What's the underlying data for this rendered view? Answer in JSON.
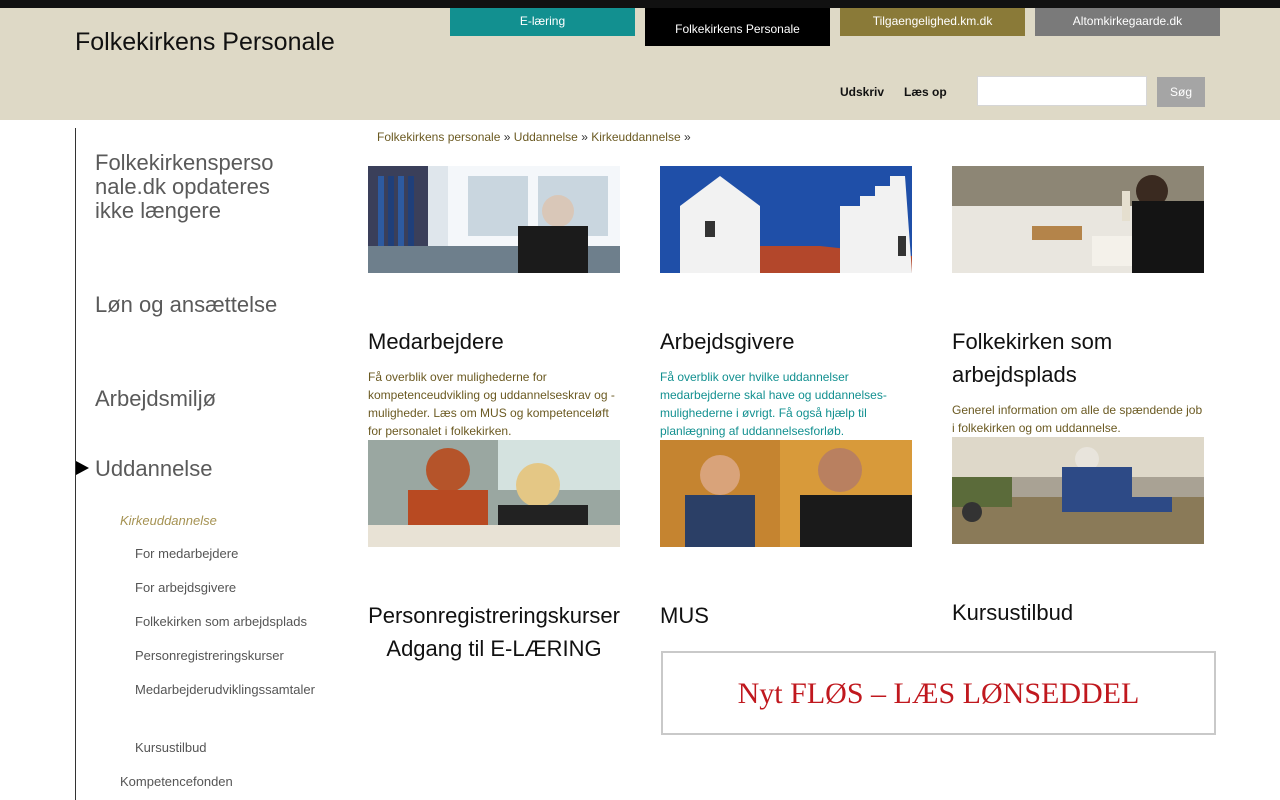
{
  "header": {
    "site_title": "Folkekirkens Personale",
    "tabs": [
      {
        "label": "E-læring",
        "color": "#129090"
      },
      {
        "label": "Folkekirkens Personale",
        "color": "#000000"
      },
      {
        "label": "Tilgaengelighed.km.dk",
        "color": "#8a7a38"
      },
      {
        "label": "Altomkirkegaarde.dk",
        "color": "#7a7a7a"
      }
    ],
    "print_label": "Udskriv",
    "read_label": "Læs op",
    "search_value": "",
    "search_button": "Søg"
  },
  "sidebar": {
    "main": [
      "Folkekirkenspersonale.dk opdateres ikke længere",
      "Løn og ansættelse",
      "Arbejdsmiljø",
      "Uddannelse"
    ],
    "active_sub": "Kirkeuddannelse",
    "sub_items": [
      "For medarbejdere",
      "For arbejdsgivere",
      "Folkekirken som arbejdsplads",
      "Personregistreringskurser",
      "Medarbejderudviklingssamtaler",
      "Kursustilbud"
    ],
    "next_sub": "Kompetencefonden"
  },
  "breadcrumb": {
    "items": [
      "Folkekirkens personale",
      "Uddannelse",
      "Kirkeuddannelse"
    ],
    "separator": "»"
  },
  "cards": {
    "row1": [
      {
        "title": "Medarbejdere",
        "desc": "Få overblik over mulighederne for kompetenceudvikling og uddannelseskrav og -muligheder. Læs om MUS og kompetenceløft for personalet i folkekirken."
      },
      {
        "title": "Arbejdsgivere",
        "desc": "Få overblik over hvilke uddannelser medarbejderne skal have og uddannelses-mulighederne i øvrigt. Få også hjælp til planlægning af uddannelsesforløb."
      },
      {
        "title": "Folkekirken som arbejdsplads",
        "desc": "Generel information om alle de spændende job i folkekirken og om uddannelse."
      }
    ],
    "row2": [
      {
        "title_line1": "Personregistreringskurser",
        "title_line2": "Adgang til E-LÆRING"
      },
      {
        "title": "MUS"
      },
      {
        "title": "Kursustilbud"
      }
    ]
  },
  "banner": {
    "text": "Nyt FLØS – LÆS LØNSEDDEL"
  }
}
